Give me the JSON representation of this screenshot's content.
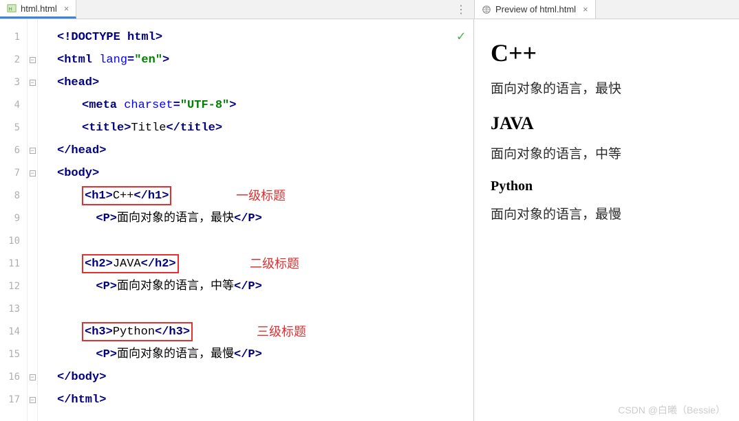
{
  "tabs": {
    "left": {
      "label": "html.html"
    },
    "right": {
      "label": "Preview of html.html"
    }
  },
  "gutter": [
    "1",
    "2",
    "3",
    "4",
    "5",
    "6",
    "7",
    "8",
    "9",
    "10",
    "11",
    "12",
    "13",
    "14",
    "15",
    "16",
    "17"
  ],
  "code": {
    "l1_doctype": "<!DOCTYPE ",
    "l1_html": "html",
    "l1_end": ">",
    "l2_open": "<html ",
    "l2_attr": "lang",
    "l2_eq": "=",
    "l2_val": "\"en\"",
    "l2_close": ">",
    "l3_open": "<head>",
    "l4_open": "<meta ",
    "l4_attr": "charset",
    "l4_eq": "=",
    "l4_val": "\"UTF-8\"",
    "l4_close": ">",
    "l5_open": "<title>",
    "l5_text": "Title",
    "l5_close": "</title>",
    "l6": "</head>",
    "l7": "<body>",
    "l8_open": "<h1>",
    "l8_text": "C++",
    "l8_close": "</h1>",
    "l9_open": "<P>",
    "l9_text": "面向对象的语言，最快",
    "l9_close": "</P>",
    "l11_open": "<h2>",
    "l11_text": "JAVA",
    "l11_close": "</h2>",
    "l12_open": "<P>",
    "l12_text": "面向对象的语言，中等",
    "l12_close": "</P>",
    "l14_open": "<h3>",
    "l14_text": "Python",
    "l14_close": "</h3>",
    "l15_open": "<P>",
    "l15_text": "面向对象的语言，最慢",
    "l15_close": "</P>",
    "l16": "</body>",
    "l17": "</html>"
  },
  "annotations": {
    "a1": "一级标题",
    "a2": "二级标题",
    "a3": "三级标题"
  },
  "preview": {
    "h1": "C++",
    "p1": "面向对象的语言，最快",
    "h2": "JAVA",
    "p2": "面向对象的语言，中等",
    "h3": "Python",
    "p3": "面向对象的语言，最慢"
  },
  "watermark": "CSDN @白曦（Bessie）"
}
